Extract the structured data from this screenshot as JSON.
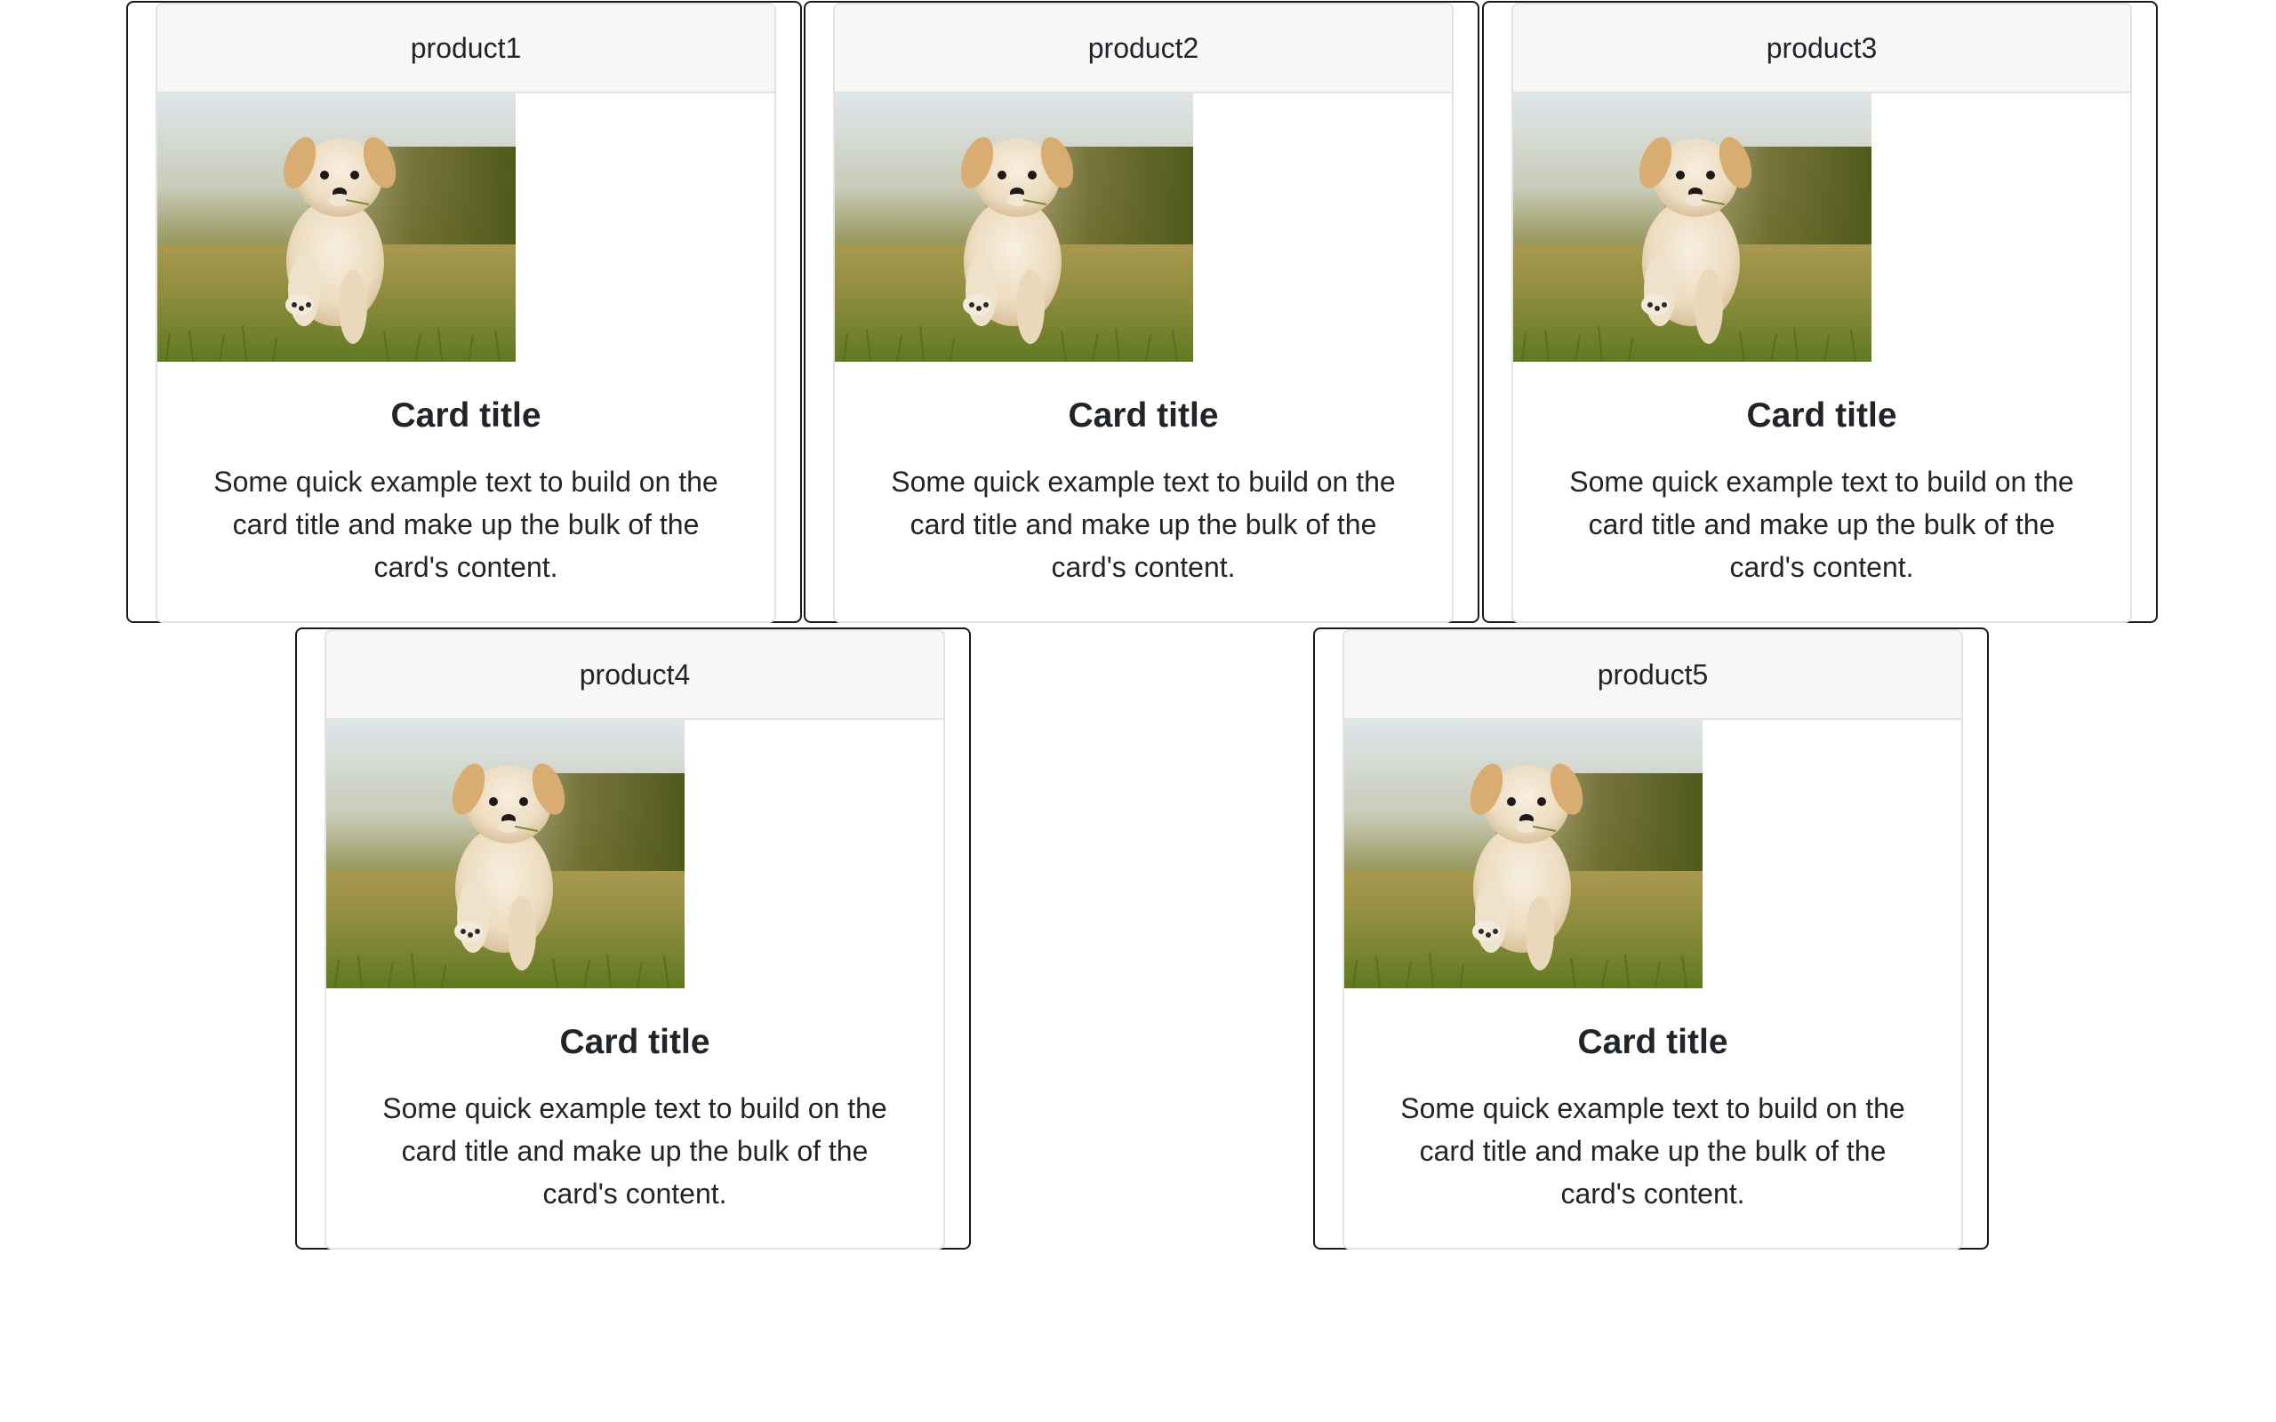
{
  "cards": [
    {
      "header": "product1",
      "title": "Card title",
      "text": "Some quick example text to build on the card title and make up the bulk of the card's content."
    },
    {
      "header": "product2",
      "title": "Card title",
      "text": "Some quick example text to build on the card title and make up the bulk of the card's content."
    },
    {
      "header": "product3",
      "title": "Card title",
      "text": "Some quick example text to build on the card title and make up the bulk of the card's content."
    },
    {
      "header": "product4",
      "title": "Card title",
      "text": "Some quick example text to build on the card title and make up the bulk of the card's content."
    },
    {
      "header": "product5",
      "title": "Card title",
      "text": "Some quick example text to build on the card title and make up the bulk of the card's content."
    }
  ],
  "image": {
    "alt": "puppy-photo"
  },
  "colors": {
    "header_bg": "#f7f7f7",
    "border_outer": "#1a1a1a",
    "border_inner": "#e3e3e3"
  }
}
